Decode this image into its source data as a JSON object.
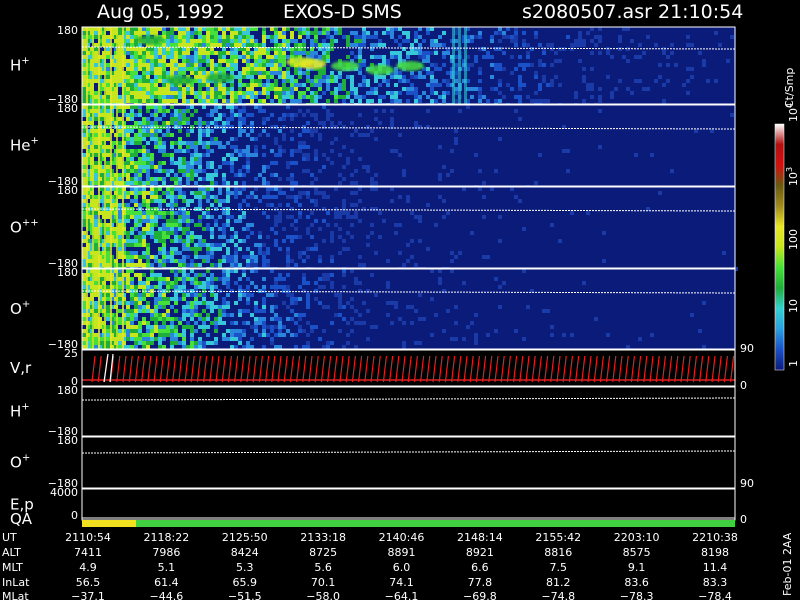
{
  "header": {
    "date": "Aug 05, 1992",
    "instrument": "EXOS-D SMS",
    "file": "s2080507.asr",
    "time": "21:10:54"
  },
  "footer_note": "Feb-01 2AA",
  "colorbar": {
    "title": "Ct/Smp",
    "labels": [
      "1",
      "10",
      "100",
      "10",
      "10"
    ],
    "exponents": [
      "",
      "",
      "",
      "3",
      "4"
    ],
    "stops": [
      "#0b1b7a",
      "#1a50c8",
      "#2aa0e0",
      "#36d0d0",
      "#1fae3a",
      "#46e03a",
      "#c8e61e",
      "#e8e628",
      "#a08a1e",
      "#6a5a10",
      "#d21010",
      "#b01010",
      "#ffffff"
    ]
  },
  "chart_data": [
    {
      "type": "heatmap",
      "name_label": "H",
      "charge": "+",
      "y_ticks": [
        "180",
        "−180"
      ],
      "intensity_profile": [
        1.0,
        0.95,
        0.85,
        0.55,
        0.42,
        0.25,
        0.12,
        0.05
      ]
    },
    {
      "type": "heatmap",
      "name_label": "He",
      "charge": "+",
      "y_ticks": [
        "180",
        "−180"
      ],
      "intensity_profile": [
        1.0,
        0.7,
        0.35,
        0.12,
        0.05,
        0.02,
        0.01,
        0.01
      ]
    },
    {
      "type": "heatmap",
      "name_label": "O",
      "charge": "++",
      "y_ticks": [
        "180",
        "−180"
      ],
      "intensity_profile": [
        1.0,
        0.7,
        0.35,
        0.15,
        0.06,
        0.02,
        0.01,
        0.01
      ]
    },
    {
      "type": "heatmap",
      "name_label": "O",
      "charge": "+",
      "y_ticks": [
        "180",
        "−180"
      ],
      "right_tick": "90",
      "intensity_profile": [
        1.0,
        0.72,
        0.4,
        0.18,
        0.07,
        0.02,
        0.01,
        0.01
      ]
    },
    {
      "type": "line",
      "name_label": "V,r",
      "y_ticks": [
        "25",
        "0"
      ],
      "right_tick": "0"
    },
    {
      "type": "line",
      "name_label": "H",
      "charge": "+",
      "y_ticks": [
        "180",
        "−180"
      ]
    },
    {
      "type": "line",
      "name_label": "O",
      "charge": "+",
      "y_ticks": [
        "180",
        "−180"
      ]
    },
    {
      "type": "line",
      "name_label": "E,p",
      "y_ticks": [
        "4000",
        "0"
      ],
      "right_ticks": [
        "90",
        "0"
      ]
    },
    {
      "type": "bar",
      "name_label": "QA"
    }
  ],
  "ephemeris": {
    "row_labels": [
      "UT",
      "ALT",
      "MLT",
      "InLat",
      "MLat"
    ],
    "columns": [
      [
        "2110:54",
        "7411",
        "4.9",
        "56.5",
        "−37.1"
      ],
      [
        "2118:22",
        "7986",
        "5.1",
        "61.4",
        "−44.6"
      ],
      [
        "2125:50",
        "8424",
        "5.3",
        "65.9",
        "−51.5"
      ],
      [
        "2133:18",
        "8725",
        "5.6",
        "70.1",
        "−58.0"
      ],
      [
        "2140:46",
        "8891",
        "6.0",
        "74.1",
        "−64.1"
      ],
      [
        "2148:14",
        "8921",
        "6.6",
        "77.8",
        "−69.8"
      ],
      [
        "2155:42",
        "8816",
        "7.5",
        "81.2",
        "−74.8"
      ],
      [
        "2203:10",
        "8575",
        "9.1",
        "83.6",
        "−78.3"
      ],
      [
        "2210:38",
        "8198",
        "11.4",
        "83.3",
        "−78.4"
      ]
    ]
  }
}
